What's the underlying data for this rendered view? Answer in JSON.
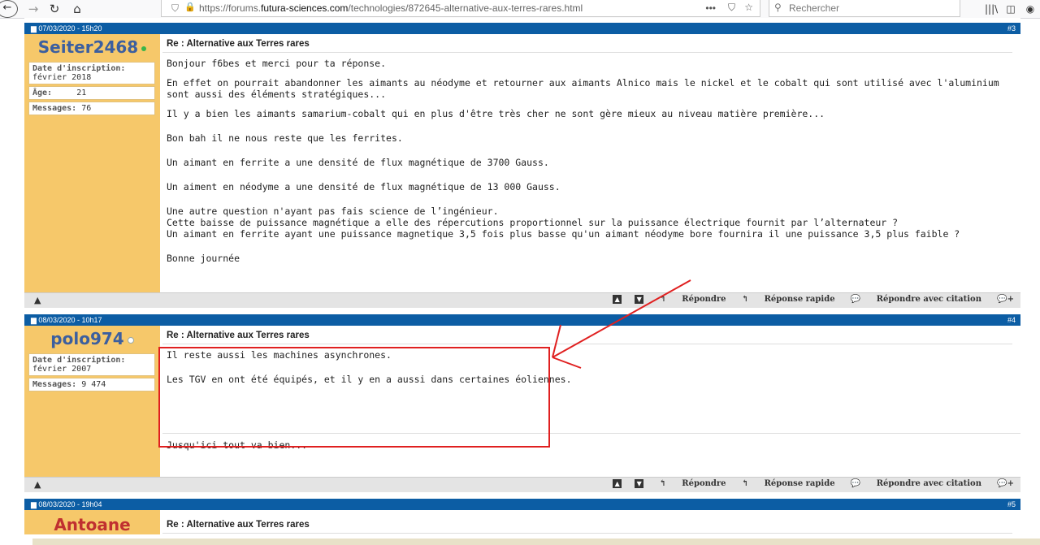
{
  "browser": {
    "url_prefix": "https://forums.",
    "url_domain": "futura-sciences.com",
    "url_path": "/technologies/872645-alternative-aux-terres-rares.html",
    "search_placeholder": "Rechercher",
    "menu_dots": "•••"
  },
  "posts": [
    {
      "date": "07/03/2020 - 15h20",
      "number": "#3",
      "username": "Seiter2468",
      "online_color": "#39b54a",
      "info": [
        {
          "label": "Date d'inscription:",
          "value": "février 2018"
        },
        {
          "label": "Âge:",
          "value": "21"
        },
        {
          "label": "Messages:",
          "value": "76"
        }
      ],
      "title": "Re : Alternative aux Terres rares",
      "paragraphs": [
        "Bonjour f6bes et merci pour ta réponse.",
        "En effet on pourrait abandonner les aimants au néodyme et retourner aux aimants Alnico mais le nickel et le cobalt qui sont utilisé avec l'aluminium sont aussi des éléments stratégiques...",
        "Il y a bien les aimants samarium-cobalt qui en plus d'être très cher ne sont gère mieux au niveau matière première...",
        "Bon bah il ne nous reste que les ferrites.",
        "Un aimant en ferrite a une densité de flux magnétique de 3700 Gauss.",
        "Un aiment en néodyme a une densité de flux magnétique de 13 000 Gauss.",
        "Une autre question n'ayant pas fais science de l’ingénieur.\nCette baisse de puissance magnétique a elle des répercutions proportionnel sur la puissance électrique fournit par l’alternateur ?\nUn aimant en ferrite ayant une puissance magnetique 3,5 fois plus basse qu'un aimant néodyme bore fournira il une puissance 3,5 plus faible ?",
        "Bonne journée"
      ]
    },
    {
      "date": "08/03/2020 - 10h17",
      "number": "#4",
      "username": "polo974",
      "online_color": "#9aa",
      "info": [
        {
          "label": "Date d'inscription:",
          "value": "février 2007"
        },
        {
          "label": "Messages:",
          "value": "9 474"
        }
      ],
      "title": "Re : Alternative aux Terres rares",
      "paragraphs": [
        "Il reste aussi les machines asynchrones.",
        "Les TGV en ont été équipés, et il y en a aussi dans certaines éoliennes."
      ],
      "signature": "Jusqu'ici tout va bien..."
    },
    {
      "date": "08/03/2020 - 19h04",
      "number": "#5",
      "username": "Antoane",
      "title": "Re : Alternative aux Terres rares"
    }
  ],
  "actions": {
    "reply": "Répondre",
    "quick_reply": "Réponse rapide",
    "reply_quote": "Répondre avec citation"
  },
  "colors": {
    "header_blue": "#0c5da4",
    "sidebar_orange": "#f6c86a",
    "annotation_red": "#e02020"
  }
}
